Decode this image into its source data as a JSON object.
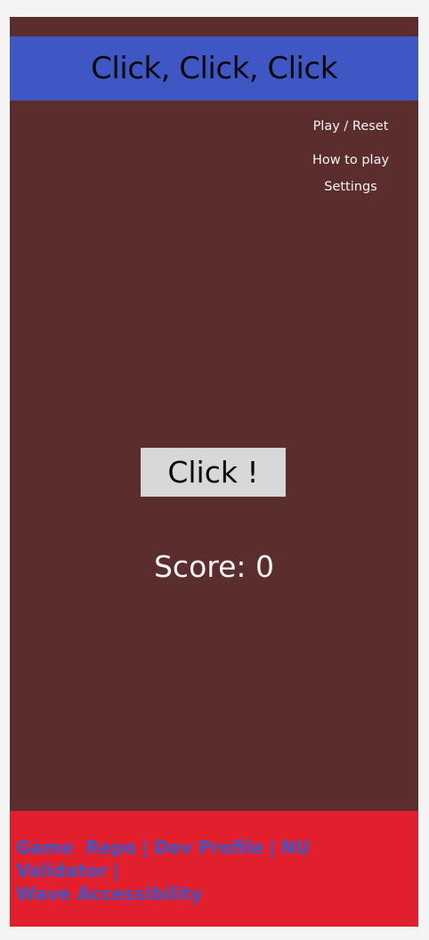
{
  "header": {
    "title": "Click, Click, Click"
  },
  "menu": {
    "items": [
      "Play / Reset",
      "How to play",
      "Settings"
    ]
  },
  "game": {
    "button_label": "Click !",
    "score_text": "Score: 0"
  },
  "footer": {
    "links": [
      "Game  Repo",
      "Dev Profile",
      "NU Validator",
      "Wave Accessibility"
    ],
    "separator": "|"
  },
  "colors": {
    "background": "#f4f4f4",
    "frame": "#5b2e2d",
    "header": "#3e57c5",
    "footer": "#e11f2d",
    "button": "#d8d8d8",
    "link": "#3e57c5"
  }
}
